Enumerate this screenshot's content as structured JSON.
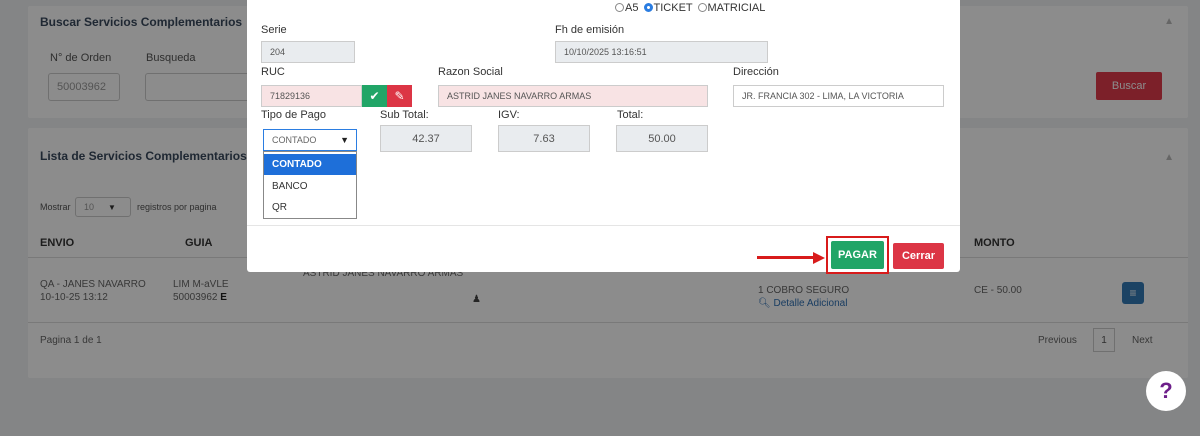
{
  "background": {
    "search_card": {
      "title": "Buscar Servicios Complementarios",
      "order_label": "N° de Orden",
      "order_value": "50003962",
      "search_label": "Busqueda",
      "search_button": "Buscar"
    },
    "list_card": {
      "title": "Lista de Servicios Complementarios",
      "show_label": "Mostrar",
      "page_size": "10",
      "records_label": "registros por pagina",
      "columns": {
        "envio": "ENVIO",
        "guia": "GUIA",
        "monto": "MONTO"
      },
      "row": {
        "envio_line1": "QA - JANES NAVARRO",
        "envio_line2": "10-10-25 13:12",
        "guia_line1": "LIM M-aVLE",
        "guia_line2": "50003962",
        "guia_badge": "E",
        "cliente": "ASTRID JANES NAVARRO ARMAS",
        "servicio_line1": "1 COBRO SEGURO",
        "servicio_link": "Detalle Adicional",
        "monto": "CE - 50.00"
      },
      "pagination": {
        "summary": "Pagina 1 de 1",
        "previous": "Previous",
        "current": "1",
        "next": "Next"
      }
    },
    "help_button": "?"
  },
  "modal": {
    "format_options": [
      {
        "label": "A5",
        "selected": false
      },
      {
        "label": "TICKET",
        "selected": true
      },
      {
        "label": "MATRICIAL",
        "selected": false
      }
    ],
    "serie": {
      "label": "Serie",
      "value": "204"
    },
    "fecha": {
      "label": "Fh de emisión",
      "value": "10/10/2025 13:16:51"
    },
    "ruc": {
      "label": "RUC",
      "value": "71829136"
    },
    "razon_social": {
      "label": "Razon Social",
      "value": "ASTRID JANES NAVARRO ARMAS"
    },
    "direccion": {
      "label": "Dirección",
      "value": "JR. FRANCIA 302 - LIMA, LA VICTORIA"
    },
    "tipo_pago": {
      "label": "Tipo de Pago",
      "value": "CONTADO",
      "options": [
        "CONTADO",
        "BANCO",
        "QR"
      ],
      "highlighted": "CONTADO"
    },
    "sub_total": {
      "label": "Sub Total:",
      "value": "42.37"
    },
    "igv": {
      "label": "IGV:",
      "value": "7.63"
    },
    "total": {
      "label": "Total:",
      "value": "50.00"
    },
    "pagar_button": "PAGAR",
    "cerrar_button": "Cerrar",
    "colors": {
      "success": "#21a567",
      "danger": "#dc3545",
      "annotation": "#d81b1b",
      "selected_option": "#1e6fd9"
    }
  }
}
